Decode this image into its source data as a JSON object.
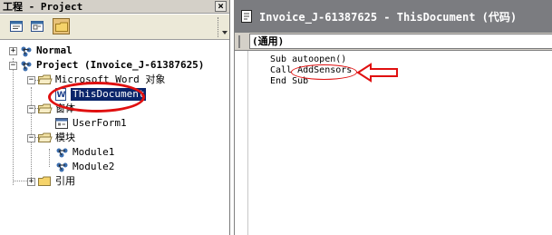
{
  "project_panel": {
    "title": "工程 - Project",
    "close": "×",
    "tree": [
      {
        "label": "Normal"
      },
      {
        "label": "Project (Invoice_J-61387625)"
      },
      {
        "label": "Microsoft Word 对象"
      },
      {
        "label": "ThisDocument"
      },
      {
        "label": "窗体"
      },
      {
        "label": "UserForm1"
      },
      {
        "label": "模块"
      },
      {
        "label": "Module1"
      },
      {
        "label": "Module2"
      },
      {
        "label": "引用"
      }
    ]
  },
  "code_window": {
    "title": "Invoice_J-61387625 - ThisDocument (代码)",
    "combo_value": "(通用)",
    "lines": [
      "Sub autoopen()",
      "Call AddSensors",
      "End Sub"
    ]
  },
  "colors": {
    "annotation": "#e01010",
    "selection": "#0a246a",
    "code_title_bg": "#7b7c80"
  }
}
